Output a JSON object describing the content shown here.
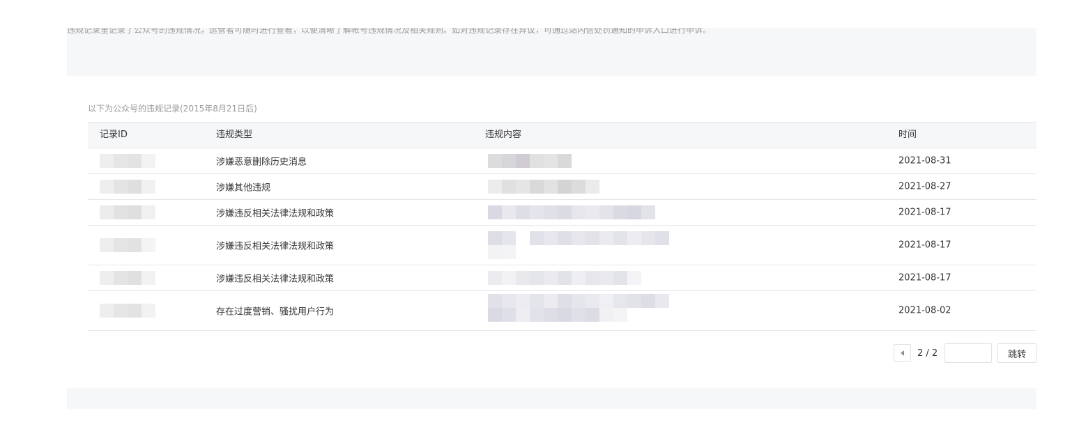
{
  "notice": {
    "text": "违规记录里记录了公众号的违规情况，运营者可随时进行查看，以便清晰了解帐号违规情况及相关规则。如对违规记录存在异议，可通过站内信处罚通知的申诉入口进行申诉。"
  },
  "records": {
    "caption": "以下为公众号的违规记录(2015年8月21日后)",
    "columns": {
      "id": "记录ID",
      "type": "违规类型",
      "content": "违规内容",
      "time": "时间"
    },
    "rows": [
      {
        "type": "涉嫌恶意删除历史消息",
        "time": "2021-08-31"
      },
      {
        "type": "涉嫌其他违规",
        "time": "2021-08-27"
      },
      {
        "type": "涉嫌违反相关法律法规和政策",
        "time": "2021-08-17"
      },
      {
        "type": "涉嫌违反相关法律法规和政策",
        "time": "2021-08-17"
      },
      {
        "type": "涉嫌违反相关法律法规和政策",
        "time": "2021-08-17"
      },
      {
        "type": "存在过度营销、骚扰用户行为",
        "time": "2021-08-02"
      }
    ]
  },
  "pager": {
    "current": "2 / 2",
    "input_value": "",
    "go_label": "跳转"
  }
}
